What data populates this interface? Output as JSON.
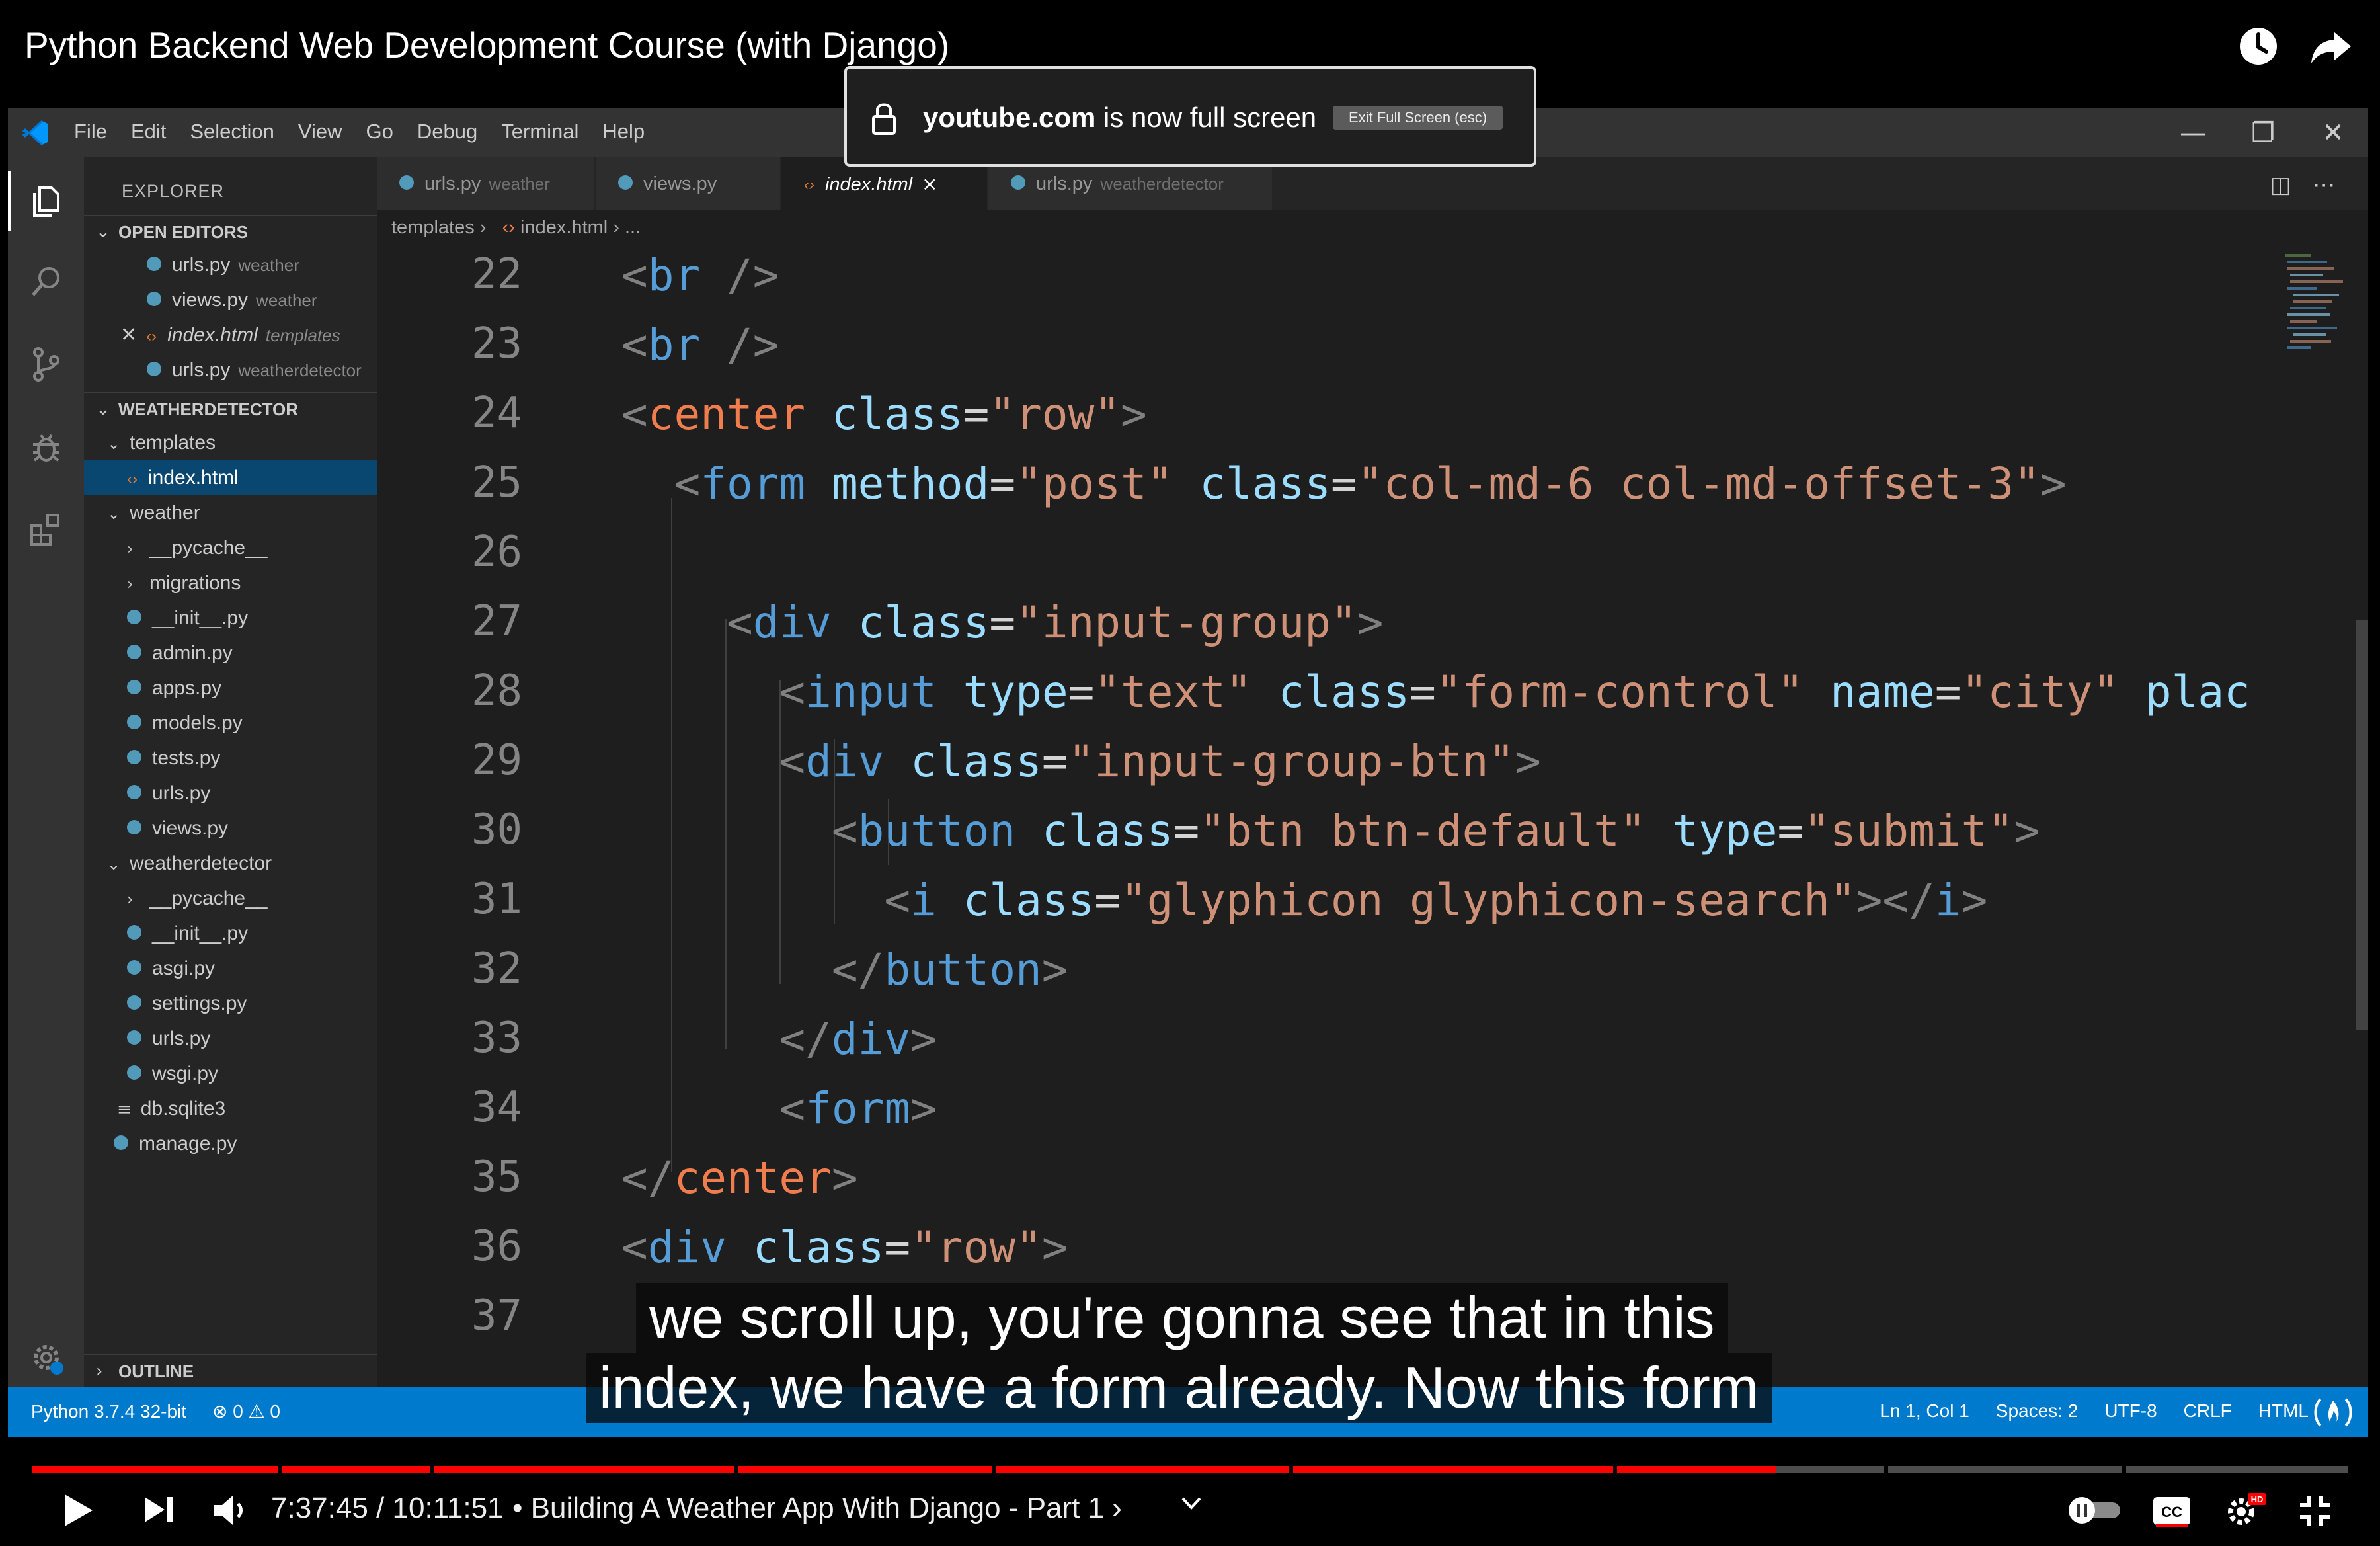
{
  "video": {
    "title": "Python Backend Web Development Course (with Django)",
    "watch_later_icon": "clock-icon",
    "share_icon": "share-arrow-icon"
  },
  "fullscreen_notice": {
    "domain": "youtube.com",
    "message": " is now full screen",
    "exit_label": "Exit Full Screen (esc)"
  },
  "menubar": {
    "items": [
      "File",
      "Edit",
      "Selection",
      "View",
      "Go",
      "Debug",
      "Terminal",
      "Help"
    ]
  },
  "sidebar": {
    "title": "EXPLORER",
    "open_editors_label": "OPEN EDITORS",
    "open_editors": [
      {
        "name": "urls.py",
        "folder": "weather"
      },
      {
        "name": "views.py",
        "folder": "weather"
      },
      {
        "name": "index.html",
        "folder": "templates"
      },
      {
        "name": "urls.py",
        "folder": "weatherdetector"
      }
    ],
    "project_label": "WEATHERDETECTOR",
    "tree": [
      "templates",
      "index.html",
      "weather",
      "__pycache__",
      "migrations",
      "__init__.py",
      "admin.py",
      "apps.py",
      "models.py",
      "tests.py",
      "urls.py",
      "views.py",
      "weatherdetector",
      "__pycache__",
      "__init__.py",
      "asgi.py",
      "settings.py",
      "urls.py",
      "wsgi.py",
      "db.sqlite3",
      "manage.py"
    ],
    "outline_label": "OUTLINE"
  },
  "tabs": [
    {
      "name": "urls.py",
      "folder": "weather"
    },
    {
      "name": "views.py",
      "folder": ""
    },
    {
      "name": "index.html",
      "folder": "",
      "close": "×"
    },
    {
      "name": "urls.py",
      "folder": "weatherdetector"
    }
  ],
  "breadcrumb": {
    "folder": "templates",
    "file": "index.html",
    "tail": "..."
  },
  "editor": {
    "line_numbers": [
      "22",
      "23",
      "24",
      "25",
      "26",
      "27",
      "28",
      "29",
      "30",
      "31",
      "32",
      "33",
      "34",
      "35",
      "36",
      "37"
    ]
  },
  "statusbar": {
    "interpreter": "Python 3.7.4 32-bit",
    "problems": "⊗ 0 ⚠ 0",
    "position": "Ln 1, Col 1",
    "spaces": "Spaces: 2",
    "encoding": "UTF-8",
    "eol": "CRLF",
    "language": "HTML"
  },
  "captions": {
    "line1": "we scroll up, you're gonna see that in this",
    "line2": "index, we have a form already. Now this form"
  },
  "player": {
    "current_time": "7:37:45",
    "separator": " / ",
    "duration": "10:11:51",
    "chapter": "• Building A Weather App With Django - Part 1 ›",
    "progress_fraction": 0.753,
    "accent_color": "#ff0000"
  }
}
